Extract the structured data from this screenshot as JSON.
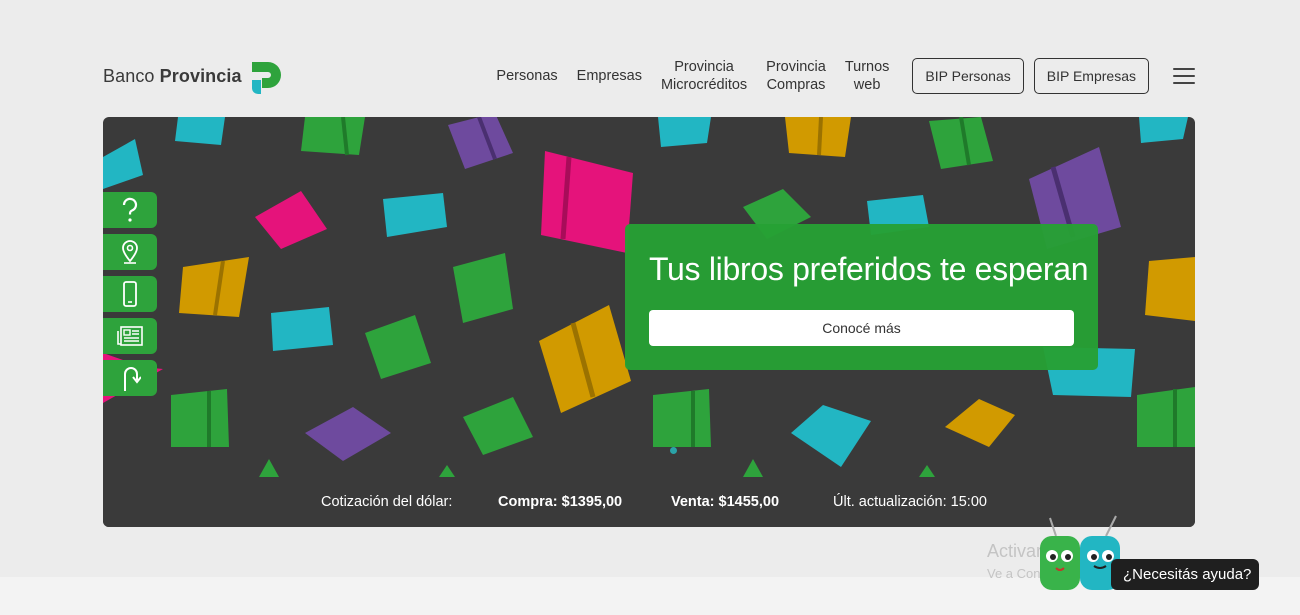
{
  "header": {
    "logo": {
      "text_regular": "Banco",
      "text_bold": "Provincia"
    },
    "nav": [
      {
        "line1": "Personas",
        "line2": ""
      },
      {
        "line1": "Empresas",
        "line2": ""
      },
      {
        "line1": "Provincia",
        "line2": "Microcréditos"
      },
      {
        "line1": "Provincia",
        "line2": "Compras"
      },
      {
        "line1": "Turnos",
        "line2": "web"
      }
    ],
    "buttons": {
      "bip_personas": "BIP Personas",
      "bip_empresas": "BIP Empresas"
    },
    "menu_icon": "hamburger-icon"
  },
  "hero": {
    "title": "Tus libros preferidos te esperan",
    "cta": "Conocé más",
    "background_color": "#3a3a3a"
  },
  "quote": {
    "label": "Cotización del dólar:",
    "buy": "Compra: $1395,00",
    "sell": "Venta: $1455,00",
    "updated": "Últ. actualización: 15:00"
  },
  "side_tools": [
    {
      "icon": "question-icon"
    },
    {
      "icon": "location-pin-icon"
    },
    {
      "icon": "mobile-phone-icon"
    },
    {
      "icon": "newspaper-icon"
    },
    {
      "icon": "arrow-return-icon"
    }
  ],
  "help": {
    "label": "¿Necesitás ayuda?"
  },
  "watermark": {
    "line1": "Activar Windows",
    "line2": "Ve a Configuración para activar Windows."
  },
  "colors": {
    "brand_green": "#2ea33c",
    "brand_teal": "#22b6c3",
    "accent_pink": "#e5137b",
    "book_purple": "#6e4a9e",
    "book_yellow": "#d19a00"
  }
}
